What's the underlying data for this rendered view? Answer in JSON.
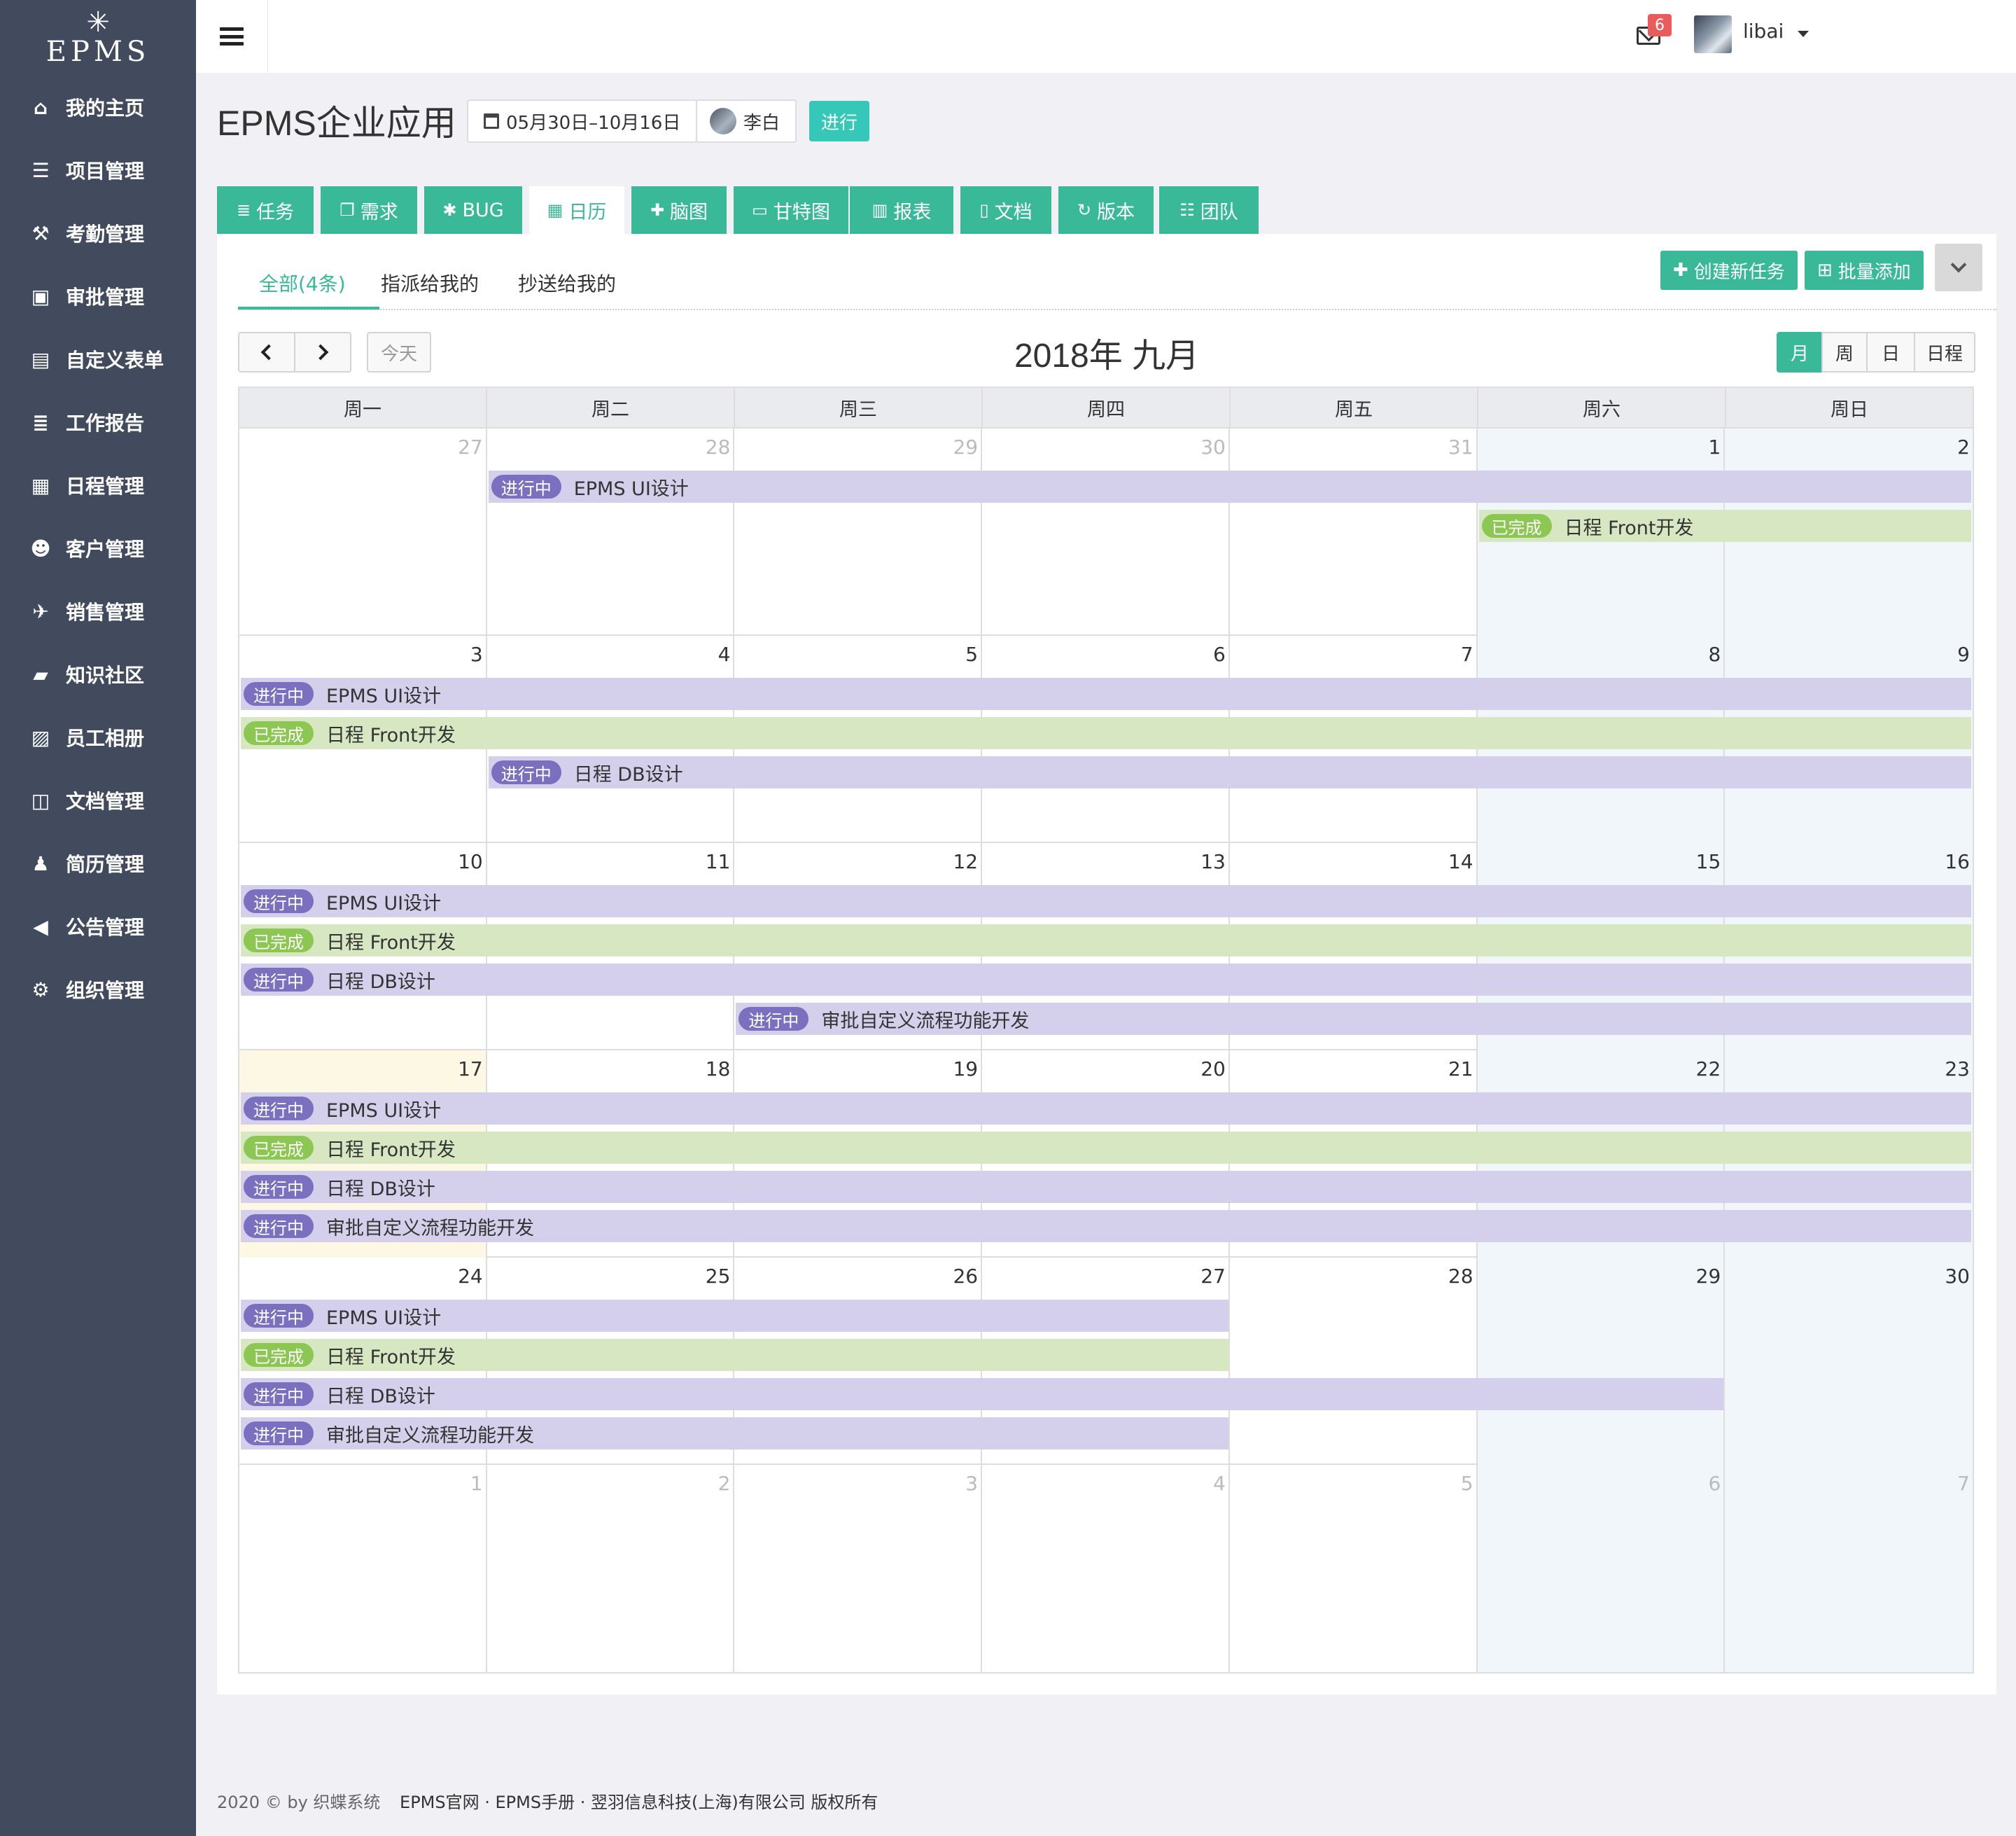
{
  "brand": {
    "logo_text": "EPMS"
  },
  "sidebar": {
    "items": [
      {
        "label": "我的主页",
        "icon": "home-icon"
      },
      {
        "label": "项目管理",
        "icon": "list-icon"
      },
      {
        "label": "考勤管理",
        "icon": "gavel-icon"
      },
      {
        "label": "审批管理",
        "icon": "briefcase-icon"
      },
      {
        "label": "自定义表单",
        "icon": "archive-icon"
      },
      {
        "label": "工作报告",
        "icon": "tasks-icon"
      },
      {
        "label": "日程管理",
        "icon": "calendar-icon"
      },
      {
        "label": "客户管理",
        "icon": "users-icon"
      },
      {
        "label": "销售管理",
        "icon": "plane-icon"
      },
      {
        "label": "知识社区",
        "icon": "book-icon"
      },
      {
        "label": "员工相册",
        "icon": "image-icon"
      },
      {
        "label": "文档管理",
        "icon": "columns-icon"
      },
      {
        "label": "简历管理",
        "icon": "person-icon"
      },
      {
        "label": "公告管理",
        "icon": "bullhorn-icon"
      },
      {
        "label": "组织管理",
        "icon": "cogs-icon"
      }
    ]
  },
  "topbar": {
    "mail_count": "6",
    "username": "libai"
  },
  "project": {
    "title": "EPMS企业应用",
    "date_range": "05月30日–10月16日",
    "owner": "李白",
    "status": "进行"
  },
  "tabs": [
    {
      "label": "任务",
      "icon": "tasks-icon"
    },
    {
      "label": "需求",
      "icon": "copy-icon"
    },
    {
      "label": "BUG",
      "icon": "bug-icon"
    },
    {
      "label": "日历",
      "icon": "calendar-icon"
    },
    {
      "label": "脑图",
      "icon": "puzzle-icon"
    },
    {
      "label": "甘特图",
      "icon": "gantt-icon"
    },
    {
      "label": "报表",
      "icon": "bar-chart-icon"
    },
    {
      "label": "文档",
      "icon": "file-icon"
    },
    {
      "label": "版本",
      "icon": "refresh-icon"
    },
    {
      "label": "团队",
      "icon": "team-icon"
    }
  ],
  "subtabs": [
    "全部(4条)",
    "指派给我的",
    "抄送给我的"
  ],
  "actions": {
    "create": "创建新任务",
    "batch": "批量添加"
  },
  "calendar": {
    "today_label": "今天",
    "title": "2018年 九月",
    "views": [
      "月",
      "周",
      "日",
      "日程"
    ],
    "active_view": "月",
    "weekdays": [
      "周一",
      "周二",
      "周三",
      "周四",
      "周五",
      "周六",
      "周日"
    ],
    "weeks": [
      {
        "days": [
          "27",
          "28",
          "29",
          "30",
          "31",
          "1",
          "2"
        ],
        "other": [
          true,
          true,
          true,
          true,
          true,
          false,
          false
        ]
      },
      {
        "days": [
          "3",
          "4",
          "5",
          "6",
          "7",
          "8",
          "9"
        ],
        "other": [
          false,
          false,
          false,
          false,
          false,
          false,
          false
        ]
      },
      {
        "days": [
          "10",
          "11",
          "12",
          "13",
          "14",
          "15",
          "16"
        ],
        "other": [
          false,
          false,
          false,
          false,
          false,
          false,
          false
        ]
      },
      {
        "days": [
          "17",
          "18",
          "19",
          "20",
          "21",
          "22",
          "23"
        ],
        "other": [
          false,
          false,
          false,
          false,
          false,
          false,
          false
        ]
      },
      {
        "days": [
          "24",
          "25",
          "26",
          "27",
          "28",
          "29",
          "30"
        ],
        "other": [
          false,
          false,
          false,
          false,
          false,
          false,
          false
        ]
      },
      {
        "days": [
          "1",
          "2",
          "3",
          "4",
          "5",
          "6",
          "7"
        ],
        "other": [
          true,
          true,
          true,
          true,
          true,
          true,
          true
        ]
      }
    ],
    "today": {
      "week": 3,
      "col": 0
    },
    "events": [
      {
        "week": 0,
        "start": 1,
        "end": 6,
        "row": 0,
        "status": "进行中",
        "title": "EPMS UI设计",
        "color": "purple"
      },
      {
        "week": 0,
        "start": 5,
        "end": 6,
        "row": 1,
        "status": "已完成",
        "title": "日程 Front开发",
        "color": "green"
      },
      {
        "week": 1,
        "start": 0,
        "end": 6,
        "row": 0,
        "status": "进行中",
        "title": "EPMS UI设计",
        "color": "purple"
      },
      {
        "week": 1,
        "start": 0,
        "end": 6,
        "row": 1,
        "status": "已完成",
        "title": "日程 Front开发",
        "color": "green"
      },
      {
        "week": 1,
        "start": 1,
        "end": 6,
        "row": 2,
        "status": "进行中",
        "title": "日程 DB设计",
        "color": "purple"
      },
      {
        "week": 2,
        "start": 0,
        "end": 6,
        "row": 0,
        "status": "进行中",
        "title": "EPMS UI设计",
        "color": "purple"
      },
      {
        "week": 2,
        "start": 0,
        "end": 6,
        "row": 1,
        "status": "已完成",
        "title": "日程 Front开发",
        "color": "green"
      },
      {
        "week": 2,
        "start": 0,
        "end": 6,
        "row": 2,
        "status": "进行中",
        "title": "日程 DB设计",
        "color": "purple"
      },
      {
        "week": 2,
        "start": 2,
        "end": 6,
        "row": 3,
        "status": "进行中",
        "title": "审批自定义流程功能开发",
        "color": "purple"
      },
      {
        "week": 3,
        "start": 0,
        "end": 6,
        "row": 0,
        "status": "进行中",
        "title": "EPMS UI设计",
        "color": "purple"
      },
      {
        "week": 3,
        "start": 0,
        "end": 6,
        "row": 1,
        "status": "已完成",
        "title": "日程 Front开发",
        "color": "green"
      },
      {
        "week": 3,
        "start": 0,
        "end": 6,
        "row": 2,
        "status": "进行中",
        "title": "日程 DB设计",
        "color": "purple"
      },
      {
        "week": 3,
        "start": 0,
        "end": 6,
        "row": 3,
        "status": "进行中",
        "title": "审批自定义流程功能开发",
        "color": "purple"
      },
      {
        "week": 4,
        "start": 0,
        "end": 3,
        "row": 0,
        "status": "进行中",
        "title": "EPMS UI设计",
        "color": "purple"
      },
      {
        "week": 4,
        "start": 0,
        "end": 3,
        "row": 1,
        "status": "已完成",
        "title": "日程 Front开发",
        "color": "green"
      },
      {
        "week": 4,
        "start": 0,
        "end": 5,
        "row": 2,
        "status": "进行中",
        "title": "日程 DB设计",
        "color": "purple"
      },
      {
        "week": 4,
        "start": 0,
        "end": 3,
        "row": 3,
        "status": "进行中",
        "title": "审批自定义流程功能开发",
        "color": "purple"
      }
    ]
  },
  "footer": {
    "copyright": "2020 © by 织蝶系统",
    "links": "EPMS官网 · EPMS手册 · 翌羽信息科技(上海)有限公司 版权所有"
  }
}
